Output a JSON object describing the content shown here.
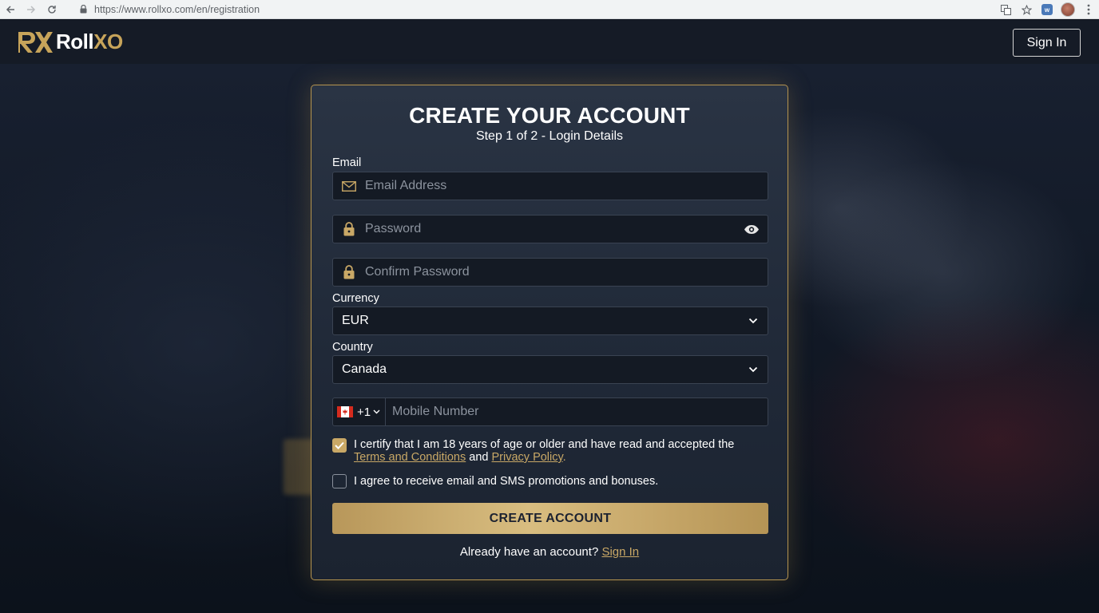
{
  "browser": {
    "url": "https://www.rollxo.com/en/registration"
  },
  "header": {
    "logo_roll": "Roll",
    "logo_xo": "XO",
    "sign_in_label": "Sign In"
  },
  "form": {
    "title": "CREATE YOUR ACCOUNT",
    "subtitle": "Step 1 of 2 - Login Details",
    "email_label": "Email",
    "email_placeholder": "Email Address",
    "password_placeholder": "Password",
    "confirm_password_placeholder": "Confirm Password",
    "currency_label": "Currency",
    "currency_value": "EUR",
    "country_label": "Country",
    "country_value": "Canada",
    "phone_prefix": "+1",
    "mobile_placeholder": "Mobile Number",
    "terms_text_1": "I certify that I am 18 years of age or older and have read and accepted the ",
    "terms_link": "Terms and Conditions",
    "terms_text_2": " and ",
    "privacy_link": "Privacy Policy",
    "terms_text_3": ".",
    "terms_checked": true,
    "promo_text": "I agree to receive email and SMS promotions and bonuses.",
    "promo_checked": false,
    "create_button_label": "CREATE ACCOUNT",
    "already_text": "Already have an account? ",
    "sign_in_link": "Sign In"
  },
  "colors": {
    "accent_gold": "#c9a866",
    "card_border": "#b5944f",
    "header_bg": "#151b26",
    "input_bg": "#141a24"
  }
}
